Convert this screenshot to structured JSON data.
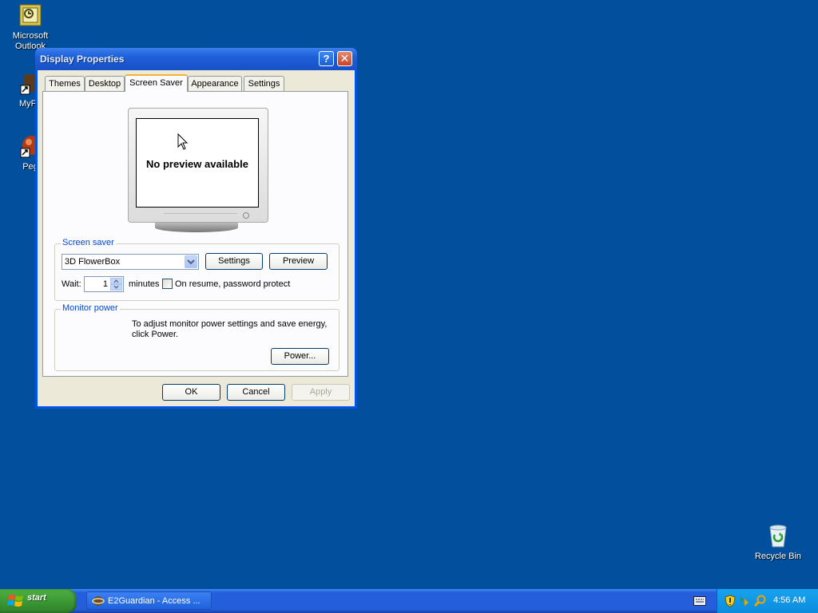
{
  "desktop": {
    "icons": [
      {
        "label": "Microsoft Outlook"
      },
      {
        "label": "MyPa"
      },
      {
        "label": "Peg"
      },
      {
        "label": "Recycle Bin"
      }
    ]
  },
  "window": {
    "title": "Display Properties",
    "tabs": [
      {
        "label": "Themes"
      },
      {
        "label": "Desktop"
      },
      {
        "label": "Screen Saver"
      },
      {
        "label": "Appearance"
      },
      {
        "label": "Settings"
      }
    ],
    "preview": {
      "message": "No preview available"
    },
    "screensaver": {
      "legend": "Screen saver",
      "selected": "3D FlowerBox",
      "settings_label": "Settings",
      "preview_label": "Preview",
      "wait_label": "Wait:",
      "wait_value": "1",
      "minutes_label": "minutes",
      "password_label": "On resume, password protect",
      "password_checked": false
    },
    "monitor_power": {
      "legend": "Monitor power",
      "text": "To adjust monitor power settings and save energy, click Power.",
      "power_label": "Power..."
    },
    "buttons": {
      "ok": "OK",
      "cancel": "Cancel",
      "apply": "Apply"
    }
  },
  "taskbar": {
    "start_label": "start",
    "task_label": "E2Guardian - Access ...",
    "clock": "4:56 AM"
  },
  "colors": {
    "desktop": "#014f9d",
    "titlebar": "#1e5fd8",
    "start": "#3c9a35",
    "taskbar": "#245edb"
  }
}
